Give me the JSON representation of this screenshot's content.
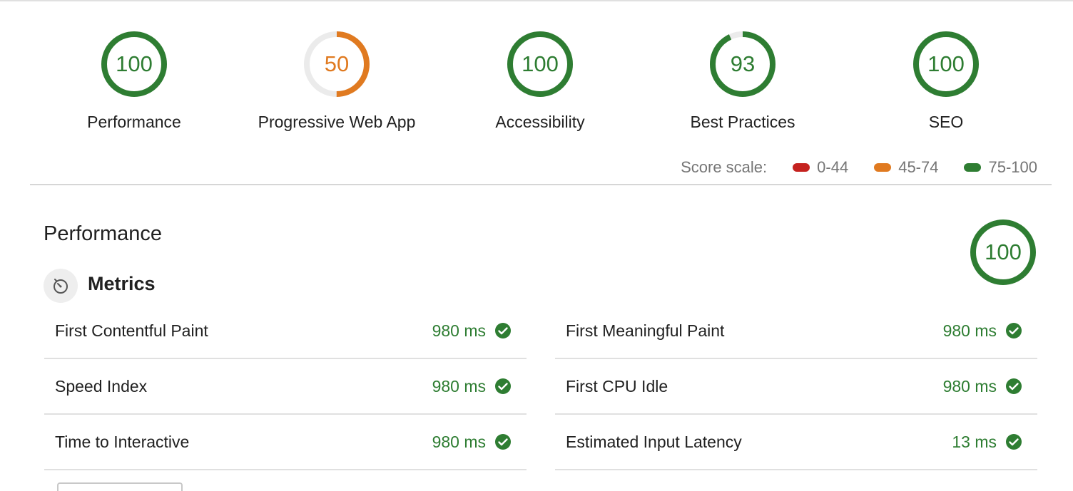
{
  "colors": {
    "pass": "#2e7d32",
    "average": "#e07a20",
    "fail": "#c5221f",
    "track": "#ebebeb"
  },
  "gauges": [
    {
      "label": "Performance",
      "score": "100",
      "status": "pass"
    },
    {
      "label": "Progressive Web App",
      "score": "50",
      "status": "average"
    },
    {
      "label": "Accessibility",
      "score": "100",
      "status": "pass"
    },
    {
      "label": "Best Practices",
      "score": "93",
      "status": "pass"
    },
    {
      "label": "SEO",
      "score": "100",
      "status": "pass"
    }
  ],
  "score_scale": {
    "title": "Score scale:",
    "ranges": [
      {
        "label": "0-44",
        "color": "#c5221f"
      },
      {
        "label": "45-74",
        "color": "#e07a20"
      },
      {
        "label": "75-100",
        "color": "#2e7d32"
      }
    ]
  },
  "section": {
    "title": "Performance",
    "score": "100",
    "metrics_title": "Metrics",
    "metrics_icon": "timer-icon"
  },
  "metrics": {
    "left": [
      {
        "name": "First Contentful Paint",
        "value": "980 ms"
      },
      {
        "name": "Speed Index",
        "value": "980 ms"
      },
      {
        "name": "Time to Interactive",
        "value": "980 ms"
      }
    ],
    "right": [
      {
        "name": "First Meaningful Paint",
        "value": "980 ms"
      },
      {
        "name": "First CPU Idle",
        "value": "980 ms"
      },
      {
        "name": "Estimated Input Latency",
        "value": "13 ms"
      }
    ]
  }
}
